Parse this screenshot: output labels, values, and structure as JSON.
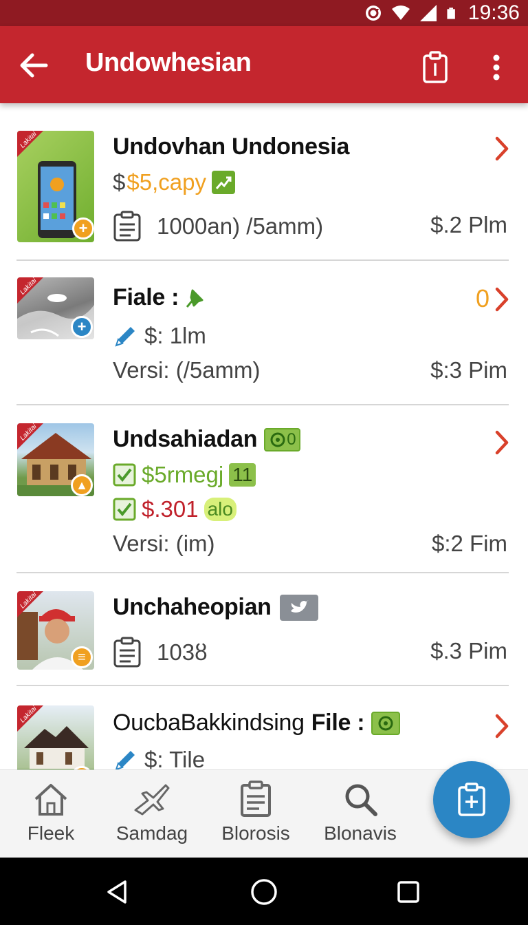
{
  "status_bar": {
    "time": "19:36"
  },
  "app_bar": {
    "title": "Undowhesian"
  },
  "items": [
    {
      "title": "Undovhan Undonesia",
      "line1_prefix": "$",
      "line1_value": "$5,capy",
      "line2": "1000an) /5amm)",
      "right": "$.2 Plm",
      "thumb_label": "Lakitai"
    },
    {
      "title": "Fiale :",
      "top_right_count": "0",
      "line1": "$: 1lm",
      "line2": "Versi: (/5amm)",
      "right": "$:3 Pim",
      "thumb_label": "Lakitai"
    },
    {
      "title": "Undsahiadan",
      "title_tag": "0",
      "line1": "$5rmegj",
      "line1_tag": "11",
      "line2": "$.301",
      "line2_tag": "alo",
      "line3": "Versi: (im)",
      "right": "$:2 Fim",
      "thumb_label": "Lakitai"
    },
    {
      "title": "Unchaheopian",
      "line1": "103ȣ",
      "right": "$.3 Pim",
      "thumb_label": "Lakitai"
    },
    {
      "title_regular": "OucbaBakkindsing",
      "title_bold": "File :",
      "line1": "$: Tile",
      "thumb_label": "Lakitai"
    }
  ],
  "bottom_nav": [
    {
      "label": "Fleek",
      "icon": "home-icon"
    },
    {
      "label": "Samdag",
      "icon": "plane-icon"
    },
    {
      "label": "Blorosis",
      "icon": "clipboard-icon"
    },
    {
      "label": "Blonavis",
      "icon": "search-icon"
    }
  ],
  "colors": {
    "app_bar": "#c4262e",
    "status_bar": "#8f1a22",
    "fab": "#2b86c5",
    "chevron": "#d9412b",
    "orange": "#f0a020",
    "green": "#6aaa2a",
    "red_price": "#c0202a"
  }
}
